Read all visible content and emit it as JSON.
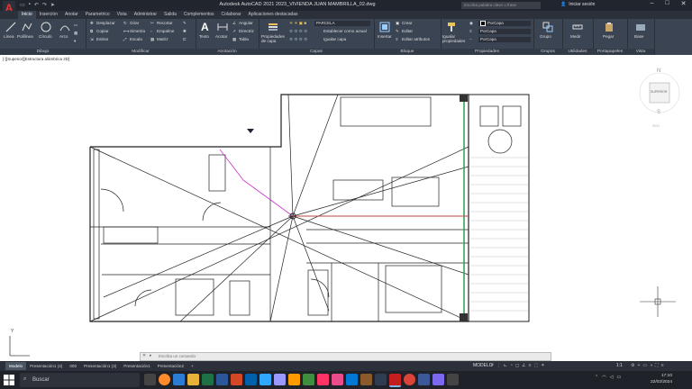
{
  "titlebar": {
    "logo_letter": "A",
    "title": "Autodesk AutoCAD 2021   2023_VIVIENDA JUAN MAMBRILLA_02.dwg",
    "search_placeholder": "Escriba palabra clave o frase",
    "signin": "Iniciar sesión",
    "controls": [
      "–",
      "□",
      "✕"
    ]
  },
  "ribbon": {
    "tabs": [
      "Inicio",
      "Inserción",
      "Anotar",
      "Parametrico",
      "Vista",
      "Administrar",
      "Salida",
      "Complementos",
      "Colaborar",
      "Aplicaciones destacadas"
    ],
    "active_tab": "Inicio",
    "dibujo": {
      "title": "Dibujo",
      "tools": [
        "Línea",
        "Polilínea",
        "Círculo",
        "Arco"
      ]
    },
    "modificar": {
      "title": "Modificar",
      "tools": [
        "Desplazar",
        "Girar",
        "Recortar",
        "Copiar",
        "Simetría",
        "Empalme",
        "Estirar",
        "Escala",
        "Matriz"
      ]
    },
    "anotacion": {
      "title": "Anotación",
      "tools": [
        "Texto",
        "Acotar",
        "Angular",
        "Directriz",
        "Tabla"
      ]
    },
    "capas": {
      "title": "Capas",
      "props_label": "Propiedades de capa",
      "layer_name": "PARCELA",
      "tools": [
        "Establecer como actual",
        "Igualar capa"
      ]
    },
    "bloque": {
      "title": "Bloque",
      "insert": "Insertar",
      "tools": [
        "Crear",
        "Editar",
        "Editar atributos"
      ]
    },
    "propiedades": {
      "title": "Propiedades",
      "match": "Igualar propiedades",
      "color_value": "PorCapa",
      "linetype_value": "PorCapa",
      "lineweight_value": "PorCapa"
    },
    "grupos": {
      "title": "Grupos",
      "tool": "Grupo"
    },
    "utilidades": {
      "title": "Utilidades",
      "tool": "Medir"
    },
    "portapapeles": {
      "title": "Portapapeles",
      "tool": "Pegar"
    },
    "vista": {
      "title": "Vista",
      "tool": "Base"
    }
  },
  "viewport": {
    "label": "[-][Superior][Estructura alámbrica 2D]",
    "viewcube": {
      "north": "N",
      "south": "S",
      "face": "SUPERIOR",
      "wcs": "SCU"
    }
  },
  "command": {
    "placeholder": "Escriba un comando"
  },
  "layouts": [
    "Modelo",
    "Presentación1 (4)",
    "000",
    "Presentación1 (3)",
    "Presentación1",
    "Presentación2",
    "+"
  ],
  "active_layout": "Modelo",
  "status": {
    "model": "MODELO",
    "scale": "1:1"
  },
  "taskbar": {
    "search": "Buscar",
    "time": "17:10",
    "date": "22/02/2024"
  },
  "colors": {
    "accent": "#3b4453",
    "title_bg": "#21262e",
    "logo_red": "#e03030",
    "drawing_line": "#222222",
    "magenta": "#cc33cc",
    "red_line": "#e04040",
    "green": "#2aa04a"
  }
}
